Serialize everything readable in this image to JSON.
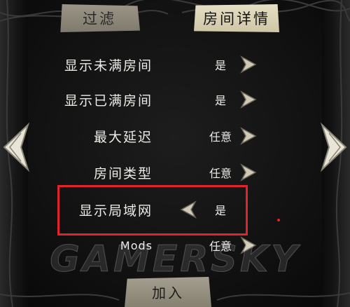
{
  "tabs": {
    "filter": "过滤",
    "room_details": "房间详情"
  },
  "rows": [
    {
      "label": "显示未满房间",
      "value": "是"
    },
    {
      "label": "显示已满房间",
      "value": "是"
    },
    {
      "label": "最大延迟",
      "value": "任意"
    },
    {
      "label": "房间类型",
      "value": "任意"
    },
    {
      "label": "显示局域网",
      "value": "是"
    },
    {
      "label": "Mods",
      "value": "任意"
    }
  ],
  "join_button": "加入",
  "watermark": "GAMERSKY",
  "icons": {
    "next": "chevron-right-icon",
    "prev": "chevron-left-icon",
    "page_left": "page-left-arrow-icon",
    "page_right": "page-right-arrow-icon"
  },
  "colors": {
    "highlight": "#e0242c",
    "text": "#ecebe6",
    "tab_active": "#ddd5b8",
    "tab_inactive": "#8d887a"
  }
}
